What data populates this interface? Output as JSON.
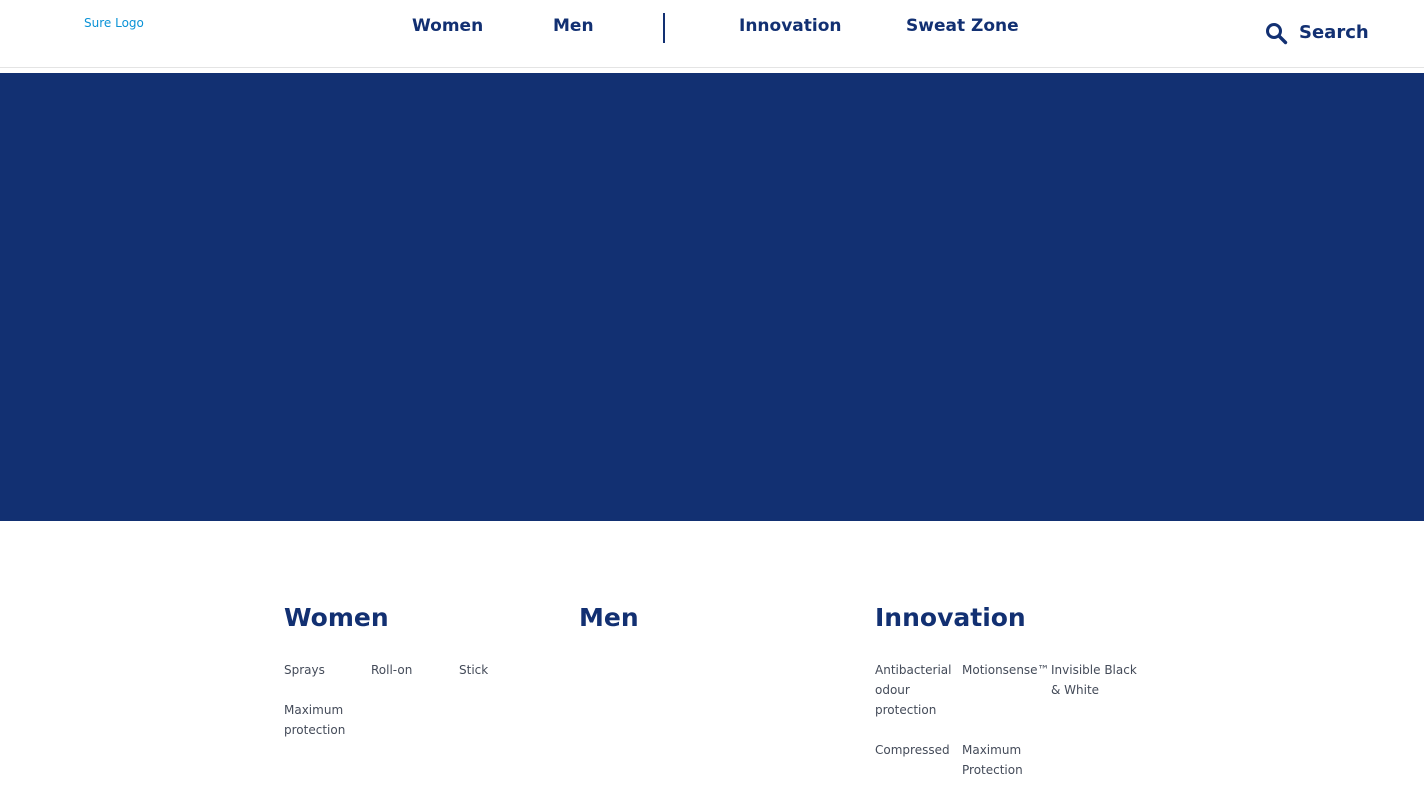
{
  "header": {
    "logo": "Sure Logo",
    "nav": [
      "Women",
      "Men",
      "Innovation",
      "Sweat Zone"
    ],
    "search_label": "Search"
  },
  "colors": {
    "brand_navy": "#123072",
    "logo_blue": "#0a92d6",
    "link_grey": "#444b59"
  },
  "icons": {
    "search": "search-icon"
  },
  "footer": {
    "women": {
      "heading": "Women",
      "links": [
        "Sprays",
        "Roll-on",
        "Stick",
        "Maximum protection"
      ]
    },
    "men": {
      "heading": "Men",
      "links": []
    },
    "innovation": {
      "heading": "Innovation",
      "links": [
        "Antibacterial odour protection",
        "Motionsense™",
        "Invisible Black & White",
        "Compressed",
        "Maximum Protection"
      ]
    }
  }
}
